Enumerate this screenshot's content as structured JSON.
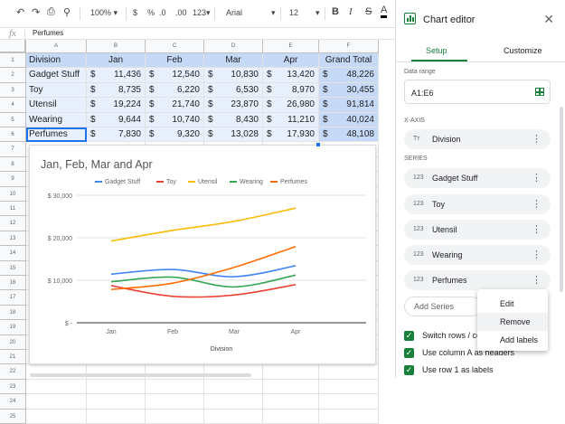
{
  "toolbar": {
    "undo_icon": "undo-icon",
    "redo_icon": "redo-icon",
    "print_icon": "print-icon",
    "paint_format_icon": "paint-format-icon",
    "zoom": "100%",
    "zoom_arrow": "▾",
    "currency": "$",
    "percent": "%",
    "decrease_decimal": ".0",
    "increase_decimal": ".00",
    "more_formats": "123▾",
    "font": "Arial",
    "font_arrow": "▾",
    "font_size": "12",
    "size_arrow": "▾",
    "bold": "B",
    "italic": "I",
    "strikethrough": "S",
    "text_color": "A"
  },
  "formula_bar": {
    "fx": "fx",
    "value": "Perfumes"
  },
  "sheet": {
    "columns": [
      "A",
      "B",
      "C",
      "D",
      "E",
      "F"
    ],
    "rows": [
      "1",
      "2",
      "3",
      "4",
      "5",
      "6",
      "7",
      "8",
      "9",
      "10",
      "11",
      "12",
      "13",
      "14",
      "15",
      "16",
      "17",
      "18",
      "19",
      "20",
      "21",
      "22",
      "23",
      "24",
      "25"
    ],
    "header": [
      "Division",
      "Jan",
      "Feb",
      "Mar",
      "Apr",
      "Grand Total"
    ],
    "data": [
      {
        "division": "Gadget Stuff",
        "vals": [
          "11,436",
          "12,540",
          "10,830",
          "13,420"
        ],
        "total": "48,226"
      },
      {
        "division": "Toy",
        "vals": [
          "8,735",
          "6,220",
          "6,530",
          "8,970"
        ],
        "total": "30,455"
      },
      {
        "division": "Utensil",
        "vals": [
          "19,224",
          "21,740",
          "23,870",
          "26,980"
        ],
        "total": "91,814"
      },
      {
        "division": "Wearing",
        "vals": [
          "9,644",
          "10,740",
          "8,430",
          "11,210"
        ],
        "total": "40,024"
      },
      {
        "division": "Perfumes",
        "vals": [
          "7,830",
          "9,320",
          "13,028",
          "17,930"
        ],
        "total": "48,108"
      }
    ],
    "currency_symbol": "$"
  },
  "chart_data": {
    "type": "line",
    "title": "Jan, Feb, Mar and Apr",
    "categories": [
      "Jan",
      "Feb",
      "Mar",
      "Apr"
    ],
    "xlabel": "Division",
    "ylabel": "",
    "yticks": [
      "$ -",
      "$ 10,000",
      "$ 20,000",
      "$ 30,000"
    ],
    "ylim": [
      0,
      30000
    ],
    "legend_position": "top",
    "grid": true,
    "smooth": true,
    "series": [
      {
        "name": "Gadget Stuff",
        "color": "#4285f4",
        "values": [
          11436,
          12540,
          10830,
          13420
        ]
      },
      {
        "name": "Toy",
        "color": "#ea4335",
        "values": [
          8735,
          6220,
          6530,
          8970
        ]
      },
      {
        "name": "Utensil",
        "color": "#fbbc04",
        "values": [
          19224,
          21740,
          23870,
          26980
        ]
      },
      {
        "name": "Wearing",
        "color": "#34a853",
        "values": [
          9644,
          10740,
          8430,
          11210
        ]
      },
      {
        "name": "Perfumes",
        "color": "#ff6d01",
        "values": [
          7830,
          9320,
          13028,
          17930
        ]
      }
    ]
  },
  "editor": {
    "title": "Chart editor",
    "close_icon": "close-icon",
    "tabs": [
      "Setup",
      "Customize"
    ],
    "data_range_label": "Data range",
    "data_range_value": "A1:E6",
    "xaxis_label": "X-AXIS",
    "xaxis_item": "Division",
    "xaxis_icon": "Tт",
    "series_label": "SERIES",
    "series_icon": "123",
    "series": [
      "Gadget Stuff",
      "Toy",
      "Utensil",
      "Wearing",
      "Perfumes"
    ],
    "kebab": "⋮",
    "add_series": "Add Series",
    "checkboxes": [
      "Switch rows / co",
      "Use column A as headers",
      "Use row 1 as labels"
    ],
    "check_mark": "✓"
  },
  "context_menu": {
    "items": [
      "Edit",
      "Remove",
      "Add labels"
    ]
  }
}
